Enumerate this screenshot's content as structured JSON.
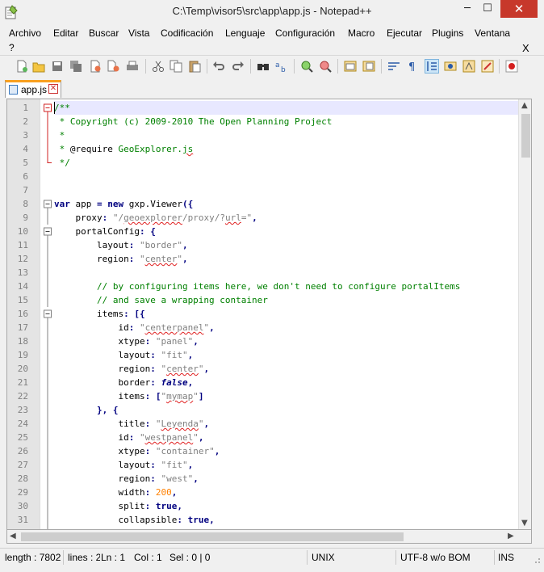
{
  "window": {
    "title": "C:\\Temp\\visor5\\src\\app\\app.js - Notepad++",
    "minimize": "─",
    "maximize": "☐",
    "close": "✕"
  },
  "menu": {
    "items": [
      "Archivo",
      "Editar",
      "Buscar",
      "Vista",
      "Codificación",
      "Lenguaje",
      "Configuración",
      "Macro",
      "Ejecutar",
      "Plugins",
      "Ventana"
    ],
    "help": "?",
    "close_doc": "X"
  },
  "toolbar": {
    "icons": [
      "new-file-icon",
      "open-file-icon",
      "save-icon",
      "save-all-icon",
      "close-icon",
      "close-all-icon",
      "print-icon",
      "cut-icon",
      "copy-icon",
      "paste-icon",
      "undo-icon",
      "redo-icon",
      "find-icon",
      "replace-icon",
      "zoom-in-icon",
      "zoom-out-icon",
      "sync-vertical-icon",
      "sync-horizontal-icon",
      "word-wrap-icon",
      "show-all-chars-icon",
      "indent-guide-icon",
      "user-lang-icon",
      "function-list-icon",
      "doc-map-icon",
      "record-macro-icon"
    ]
  },
  "tab": {
    "name": "app.js",
    "close": "✕"
  },
  "editor": {
    "lines": [
      {
        "n": "1",
        "fold": "minus-box",
        "tokens": [
          {
            "t": "/**",
            "c": "t-com"
          }
        ]
      },
      {
        "n": "2",
        "fold": "line",
        "tokens": [
          {
            "t": " * Copyright (c) 2009-2010 The Open Planning Project",
            "c": "t-com"
          }
        ]
      },
      {
        "n": "3",
        "fold": "line",
        "tokens": [
          {
            "t": " *",
            "c": "t-com"
          }
        ]
      },
      {
        "n": "4",
        "fold": "line",
        "tokens": [
          {
            "t": " * ",
            "c": "t-com"
          },
          {
            "t": "@require",
            "c": "t-def"
          },
          {
            "t": " GeoExplorer.",
            "c": "t-com"
          },
          {
            "t": "js",
            "c": "t-com squig"
          }
        ]
      },
      {
        "n": "5",
        "fold": "end",
        "tokens": [
          {
            "t": " */",
            "c": "t-com"
          }
        ]
      },
      {
        "n": "6",
        "fold": "",
        "tokens": []
      },
      {
        "n": "7",
        "fold": "",
        "tokens": []
      },
      {
        "n": "8",
        "fold": "minus-box",
        "tokens": [
          {
            "t": "var",
            "c": "t-kw"
          },
          {
            "t": " app ",
            "c": "t-txt"
          },
          {
            "t": "=",
            "c": "t-opr"
          },
          {
            "t": " ",
            "c": "t-txt"
          },
          {
            "t": "new",
            "c": "t-kw"
          },
          {
            "t": " gxp.Viewer",
            "c": "t-txt"
          },
          {
            "t": "({",
            "c": "t-opr"
          }
        ]
      },
      {
        "n": "9",
        "fold": "line",
        "tokens": [
          {
            "t": "    proxy",
            "c": "t-txt"
          },
          {
            "t": ":",
            "c": "t-opr"
          },
          {
            "t": " \"/",
            "c": "t-str"
          },
          {
            "t": "geoexplorer",
            "c": "t-str squig"
          },
          {
            "t": "/proxy/?",
            "c": "t-str"
          },
          {
            "t": "url",
            "c": "t-str squig"
          },
          {
            "t": "=\"",
            "c": "t-str"
          },
          {
            "t": ",",
            "c": "t-opr"
          }
        ]
      },
      {
        "n": "10",
        "fold": "minus-box",
        "tokens": [
          {
            "t": "    portalConfig",
            "c": "t-txt"
          },
          {
            "t": ":",
            "c": "t-opr"
          },
          {
            "t": " ",
            "c": "t-txt"
          },
          {
            "t": "{",
            "c": "t-opr"
          }
        ]
      },
      {
        "n": "11",
        "fold": "line",
        "tokens": [
          {
            "t": "        layout",
            "c": "t-txt"
          },
          {
            "t": ":",
            "c": "t-opr"
          },
          {
            "t": " \"border\"",
            "c": "t-str"
          },
          {
            "t": ",",
            "c": "t-opr"
          }
        ]
      },
      {
        "n": "12",
        "fold": "line",
        "tokens": [
          {
            "t": "        region",
            "c": "t-txt"
          },
          {
            "t": ":",
            "c": "t-opr"
          },
          {
            "t": " \"",
            "c": "t-str"
          },
          {
            "t": "center",
            "c": "t-str squig"
          },
          {
            "t": "\"",
            "c": "t-str"
          },
          {
            "t": ",",
            "c": "t-opr"
          }
        ]
      },
      {
        "n": "13",
        "fold": "line",
        "tokens": []
      },
      {
        "n": "14",
        "fold": "line",
        "tokens": [
          {
            "t": "        // by configuring items here, we don't need to configure portalItems",
            "c": "t-com"
          }
        ]
      },
      {
        "n": "15",
        "fold": "line",
        "tokens": [
          {
            "t": "        // and save a wrapping container",
            "c": "t-com"
          }
        ]
      },
      {
        "n": "16",
        "fold": "minus-box",
        "tokens": [
          {
            "t": "        items",
            "c": "t-txt"
          },
          {
            "t": ":",
            "c": "t-opr"
          },
          {
            "t": " ",
            "c": "t-txt"
          },
          {
            "t": "[{",
            "c": "t-opr"
          }
        ]
      },
      {
        "n": "17",
        "fold": "line",
        "tokens": [
          {
            "t": "            id",
            "c": "t-txt"
          },
          {
            "t": ":",
            "c": "t-opr"
          },
          {
            "t": " \"",
            "c": "t-str"
          },
          {
            "t": "centerpanel",
            "c": "t-str squig"
          },
          {
            "t": "\"",
            "c": "t-str"
          },
          {
            "t": ",",
            "c": "t-opr"
          }
        ]
      },
      {
        "n": "18",
        "fold": "line",
        "tokens": [
          {
            "t": "            xtype",
            "c": "t-txt"
          },
          {
            "t": ":",
            "c": "t-opr"
          },
          {
            "t": " \"panel\"",
            "c": "t-str"
          },
          {
            "t": ",",
            "c": "t-opr"
          }
        ]
      },
      {
        "n": "19",
        "fold": "line",
        "tokens": [
          {
            "t": "            layout",
            "c": "t-txt"
          },
          {
            "t": ":",
            "c": "t-opr"
          },
          {
            "t": " \"fit\"",
            "c": "t-str"
          },
          {
            "t": ",",
            "c": "t-opr"
          }
        ]
      },
      {
        "n": "20",
        "fold": "line",
        "tokens": [
          {
            "t": "            region",
            "c": "t-txt"
          },
          {
            "t": ":",
            "c": "t-opr"
          },
          {
            "t": " \"",
            "c": "t-str"
          },
          {
            "t": "center",
            "c": "t-str squig"
          },
          {
            "t": "\"",
            "c": "t-str"
          },
          {
            "t": ",",
            "c": "t-opr"
          }
        ]
      },
      {
        "n": "21",
        "fold": "line",
        "tokens": [
          {
            "t": "            border",
            "c": "t-txt"
          },
          {
            "t": ":",
            "c": "t-opr"
          },
          {
            "t": " ",
            "c": "t-txt"
          },
          {
            "t": "false",
            "c": "t-kwi"
          },
          {
            "t": ",",
            "c": "t-opr"
          }
        ]
      },
      {
        "n": "22",
        "fold": "line",
        "tokens": [
          {
            "t": "            items",
            "c": "t-txt"
          },
          {
            "t": ":",
            "c": "t-opr"
          },
          {
            "t": " ",
            "c": "t-txt"
          },
          {
            "t": "[",
            "c": "t-opr"
          },
          {
            "t": "\"",
            "c": "t-str"
          },
          {
            "t": "mymap",
            "c": "t-str squig"
          },
          {
            "t": "\"",
            "c": "t-str"
          },
          {
            "t": "]",
            "c": "t-opr"
          }
        ]
      },
      {
        "n": "23",
        "fold": "line",
        "tokens": [
          {
            "t": "        ",
            "c": "t-txt"
          },
          {
            "t": "},",
            "c": "t-opr"
          },
          {
            "t": " ",
            "c": "t-txt"
          },
          {
            "t": "{",
            "c": "t-opr"
          }
        ]
      },
      {
        "n": "24",
        "fold": "line",
        "tokens": [
          {
            "t": "            title",
            "c": "t-txt"
          },
          {
            "t": ":",
            "c": "t-opr"
          },
          {
            "t": " \"",
            "c": "t-str"
          },
          {
            "t": "Leyenda",
            "c": "t-str squig"
          },
          {
            "t": "\"",
            "c": "t-str"
          },
          {
            "t": ",",
            "c": "t-opr"
          }
        ]
      },
      {
        "n": "25",
        "fold": "line",
        "tokens": [
          {
            "t": "            id",
            "c": "t-txt"
          },
          {
            "t": ":",
            "c": "t-opr"
          },
          {
            "t": " \"",
            "c": "t-str"
          },
          {
            "t": "westpanel",
            "c": "t-str squig"
          },
          {
            "t": "\"",
            "c": "t-str"
          },
          {
            "t": ",",
            "c": "t-opr"
          }
        ]
      },
      {
        "n": "26",
        "fold": "line",
        "tokens": [
          {
            "t": "            xtype",
            "c": "t-txt"
          },
          {
            "t": ":",
            "c": "t-opr"
          },
          {
            "t": " \"container\"",
            "c": "t-str"
          },
          {
            "t": ",",
            "c": "t-opr"
          }
        ]
      },
      {
        "n": "27",
        "fold": "line",
        "tokens": [
          {
            "t": "            layout",
            "c": "t-txt"
          },
          {
            "t": ":",
            "c": "t-opr"
          },
          {
            "t": " \"fit\"",
            "c": "t-str"
          },
          {
            "t": ",",
            "c": "t-opr"
          }
        ]
      },
      {
        "n": "28",
        "fold": "line",
        "tokens": [
          {
            "t": "            region",
            "c": "t-txt"
          },
          {
            "t": ":",
            "c": "t-opr"
          },
          {
            "t": " \"west\"",
            "c": "t-str"
          },
          {
            "t": ",",
            "c": "t-opr"
          }
        ]
      },
      {
        "n": "29",
        "fold": "line",
        "tokens": [
          {
            "t": "            width",
            "c": "t-txt"
          },
          {
            "t": ":",
            "c": "t-opr"
          },
          {
            "t": " ",
            "c": "t-txt"
          },
          {
            "t": "200",
            "c": "t-num"
          },
          {
            "t": ",",
            "c": "t-opr"
          }
        ]
      },
      {
        "n": "30",
        "fold": "line",
        "tokens": [
          {
            "t": "            split",
            "c": "t-txt"
          },
          {
            "t": ":",
            "c": "t-opr"
          },
          {
            "t": " ",
            "c": "t-txt"
          },
          {
            "t": "true",
            "c": "t-kw"
          },
          {
            "t": ",",
            "c": "t-opr"
          }
        ]
      },
      {
        "n": "31",
        "fold": "line",
        "tokens": [
          {
            "t": "            collapsible",
            "c": "t-txt"
          },
          {
            "t": ":",
            "c": "t-opr"
          },
          {
            "t": " ",
            "c": "t-txt"
          },
          {
            "t": "true",
            "c": "t-kw"
          },
          {
            "t": ",",
            "c": "t-opr"
          }
        ]
      }
    ]
  },
  "status": {
    "length": "length : 7802",
    "lines": "lines : 2",
    "ln": "Ln : 1",
    "col": "Col : 1",
    "sel": "Sel : 0 | 0",
    "eol": "UNIX",
    "encoding": "UTF-8 w/o BOM",
    "mode": "INS"
  },
  "colors": {
    "close_button": "#c7382b",
    "comment": "#008000",
    "string": "#808080",
    "number": "#ff8000",
    "keyword": "#000080",
    "current_line": "#e8e8ff",
    "tab_accent": "#f9a020"
  }
}
